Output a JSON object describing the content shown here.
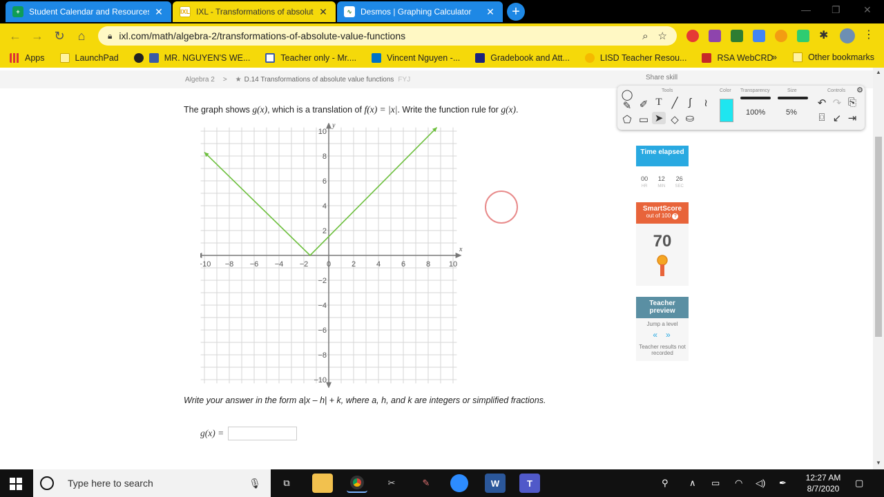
{
  "browser": {
    "tabs": [
      {
        "title": "Student Calendar and Resources",
        "color": "#1e88e5",
        "active": false
      },
      {
        "title": "IXL - Transformations of absolute",
        "color": "#f5d90a",
        "active": true
      },
      {
        "title": "Desmos | Graphing Calculator",
        "color": "#1e88e5",
        "active": false
      }
    ],
    "url": "ixl.com/math/algebra-2/transformations-of-absolute-value-functions",
    "bookmarks": [
      "Apps",
      "LaunchPad",
      "MR. NGUYEN'S WE...",
      "Teacher only - Mr....",
      "Vincent Nguyen -...",
      "Gradebook and Att...",
      "LISD Teacher Resou...",
      "RSA WebCRD"
    ],
    "bookmarks_more": "»",
    "other_bookmarks": "Other bookmarks"
  },
  "breadcrumb": {
    "course": "Algebra 2",
    "sep": ">",
    "skill": "D.14 Transformations of absolute value functions",
    "code": "FYJ"
  },
  "share_skill": "Share skill",
  "question": {
    "p1": "The graph shows ",
    "gx": "g(x)",
    "p2": ", which is a translation of ",
    "fx": "f(x) = |x|",
    "p3": ". Write the function rule for ",
    "p4": "."
  },
  "chart_data": {
    "type": "line",
    "xlabel": "x",
    "ylabel": "y",
    "xlim": [
      -10,
      10
    ],
    "ylim": [
      -10,
      10
    ],
    "x_ticks": [
      -10,
      -8,
      -6,
      -4,
      -2,
      0,
      2,
      4,
      6,
      8,
      10
    ],
    "y_ticks": [
      -10,
      -8,
      -6,
      -4,
      -2,
      2,
      4,
      6,
      8,
      10
    ],
    "grid": true,
    "series": [
      {
        "points": [
          [
            -10,
            8.3
          ],
          [
            -1.5,
            0
          ],
          [
            8.7,
            10.3
          ]
        ],
        "color": "#6cbf3c"
      }
    ]
  },
  "instructions": "Write your answer in the form a|x – h| + k, where a, h, and k are integers or simplified fractions.",
  "answer": {
    "label": "g(x) =",
    "value": ""
  },
  "sidebar": {
    "time_label": "Time elapsed",
    "timer": [
      {
        "value": "00",
        "unit": "HR"
      },
      {
        "value": "12",
        "unit": "MIN"
      },
      {
        "value": "26",
        "unit": "SEC"
      }
    ],
    "smartscore_label": "SmartScore",
    "smartscore_sub": "out of 100",
    "score": "70",
    "teacher_label": "Teacher preview",
    "jump": "Jump a level",
    "teacher_note": "Teacher results not recorded"
  },
  "toolbox": {
    "labels": {
      "tools": "Tools",
      "color": "Color",
      "transparency": "Transparency",
      "size": "Size",
      "controls": "Controls"
    },
    "transparency_value": "100%",
    "size_value": "5%",
    "color": "#1ee6f0"
  },
  "taskbar": {
    "search_placeholder": "Type here to search",
    "time": "12:27 AM",
    "date": "8/7/2020"
  }
}
